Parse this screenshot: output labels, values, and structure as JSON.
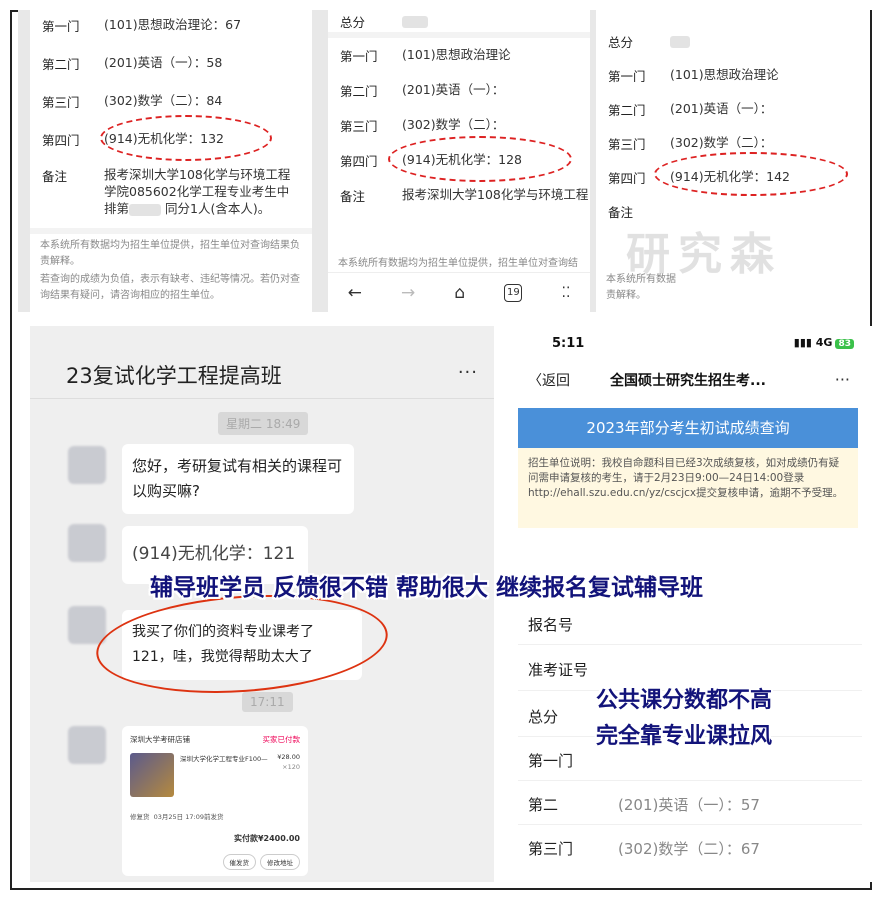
{
  "panel1": {
    "rows": [
      {
        "label": "第一门",
        "value": "(101)思想政治理论：67"
      },
      {
        "label": "第二门",
        "value": "(201)英语（一）：58"
      },
      {
        "label": "第三门",
        "value": "(302)数学（二）：84"
      },
      {
        "label": "第四门",
        "value": "(914)无机化学：132"
      }
    ],
    "remark_label": "备注",
    "remark_line1": "报考深圳大学108化学与环境工程",
    "remark_line2": "学院085602化学工程专业考生中",
    "remark_line3a": "排第",
    "remark_line3b": "同分1人(含本人)。",
    "note1": "本系统所有数据均为招生单位提供，招生单位对查询结果负责解释。",
    "note2": "若查询的成绩为负值，表示有缺考、违纪等情况。若仍对查询结果有疑问，请咨询相应的招生单位。"
  },
  "panel2": {
    "total_label": "总分",
    "rows": [
      {
        "label": "第一门",
        "value": "(101)思想政治理论"
      },
      {
        "label": "第二门",
        "value": "(201)英语（一）："
      },
      {
        "label": "第三门",
        "value": "(302)数学（二）："
      },
      {
        "label": "第四门",
        "value": "(914)无机化学：128"
      }
    ],
    "remark_label": "备注",
    "remark_value": "报考深圳大学108化学与环境工程",
    "note": "本系统所有数据均为招生单位提供，招生单位对查询结",
    "tab_count": "19"
  },
  "panel3": {
    "total_label": "总分",
    "rows": [
      {
        "label": "第一门",
        "value": "(101)思想政治理论"
      },
      {
        "label": "第二门",
        "value": "(201)英语（一）："
      },
      {
        "label": "第三门",
        "value": "(302)数学（二）："
      },
      {
        "label": "第四门",
        "value": "(914)无机化学：142"
      }
    ],
    "remark_label": "备注",
    "note1": "本系统所有数据",
    "note2": "责解释。",
    "watermark": "研究森"
  },
  "chat": {
    "title": "23复试化学工程提高班",
    "more": "···",
    "timestamp": "星期二 18:49",
    "msg1": "您好，考研复试有相关的课程可以购买嘛?",
    "msg2": "(914)无机化学：121",
    "msg3": "我买了你们的资料专业课考了121，哇，我觉得帮助太大了",
    "timestamp2": "17:11",
    "card": {
      "shop": "深圳大学考研店铺",
      "status": "买家已付款",
      "product": "深圳大学化学工程专业F100—",
      "price": "¥28.00",
      "qty": "×120",
      "seller_note": "修复货",
      "date": "03月25日 17:09前发货",
      "total": "实付款¥2400.00",
      "btn1": "催发货",
      "btn2": "修改地址"
    }
  },
  "phone": {
    "time": "5:11",
    "network": "4G",
    "battery": "83",
    "back": "〈返回",
    "title": "全国硕士研究生招生考...",
    "more": "···",
    "banner": "2023年部分考生初试成绩查询",
    "notice": "招生单位说明：我校自命题科目已经3次成绩复核，如对成绩仍有疑问需申请复核的考生，请于2月23日9:00—24日14:00登录 http://ehall.szu.edu.cn/yz/cscjcx提交复核申请，逾期不予受理。",
    "rows": [
      {
        "label": "报名号",
        "value": ""
      },
      {
        "label": "准考证号",
        "value": ""
      },
      {
        "label": "总分",
        "value": ""
      },
      {
        "label": "第一门",
        "value": ""
      },
      {
        "label": "第二",
        "value": "(201)英语（一）：57"
      },
      {
        "label": "第三门",
        "value": "(302)数学（二）：67"
      }
    ]
  },
  "overlay": {
    "headline": "辅导班学员 反馈很不错 帮助很大 继续报名复试辅导班",
    "sub1": "公共课分数都不高",
    "sub2": "完全靠专业课拉风"
  },
  "colors": {
    "accent": "#12137a",
    "banner": "#4a90d9",
    "circle": "#d22222"
  }
}
